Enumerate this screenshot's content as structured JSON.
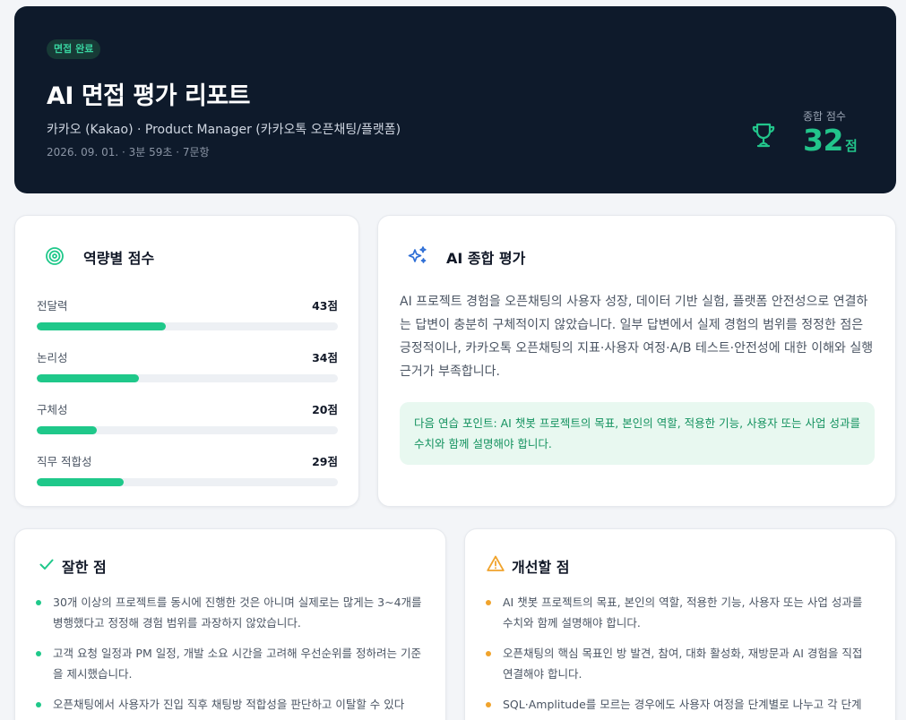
{
  "header": {
    "badge": "면접 완료",
    "title": "AI 면접 평가 리포트",
    "subtitle": "카카오 (Kakao) · Product Manager (카카오톡 오픈채팅/플랫폼)",
    "meta": "2026. 09. 01. · 3분 59초 · 7문항",
    "score_label": "종합 점수",
    "score_value": "32",
    "score_unit": "점",
    "accent_color": "#22c58b"
  },
  "competency": {
    "title": "역량별 점수",
    "icon": "target-icon",
    "items": [
      {
        "name": "전달력",
        "score": "43점",
        "percent": 43
      },
      {
        "name": "논리성",
        "score": "34점",
        "percent": 34
      },
      {
        "name": "구체성",
        "score": "20점",
        "percent": 20
      },
      {
        "name": "직무 적합성",
        "score": "29점",
        "percent": 29
      }
    ]
  },
  "summary": {
    "title": "AI 종합 평가",
    "icon": "sparkles-icon",
    "text": "AI 프로젝트 경험을 오픈채팅의 사용자 성장, 데이터 기반 실험, 플랫폼 안전성으로 연결하는 답변이 충분히 구체적이지 않았습니다. 일부 답변에서 실제 경험의 범위를 정정한 점은 긍정적이나, 카카오톡 오픈채팅의 지표·사용자 여정·A/B 테스트·안전성에 대한 이해와 실행 근거가 부족합니다.",
    "tip": "다음 연습 포인트: AI 챗봇 프로젝트의 목표, 본인의 역할, 적용한 기능, 사용자 또는 사업 성과를 수치와 함께 설명해야 합니다."
  },
  "strengths": {
    "title": "잘한 점",
    "icon": "check-icon",
    "items": [
      "30개 이상의 프로젝트를 동시에 진행한 것은 아니며 실제로는 많게는 3~4개를 병행했다고 정정해 경험 범위를 과장하지 않았습니다.",
      "고객 요청 일정과 PM 일정, 개발 소요 시간을 고려해 우선순위를 정하려는 기준을 제시했습니다.",
      "오픈채팅에서 사용자가 진입 직후 채팅방 적합성을 판단하고 이탈할 수 있다"
    ]
  },
  "improvements": {
    "title": "개선할 점",
    "icon": "warning-icon",
    "items": [
      "AI 챗봇 프로젝트의 목표, 본인의 역할, 적용한 기능, 사용자 또는 사업 성과를 수치와 함께 설명해야 합니다.",
      "오픈채팅의 핵심 목표인 방 발견, 참여, 대화 활성화, 재방문과 AI 경험을 직접 연결해야 합니다.",
      "SQL·Amplitude를 모르는 경우에도 사용자 여정을 단계별로 나누고 각 단계"
    ]
  }
}
